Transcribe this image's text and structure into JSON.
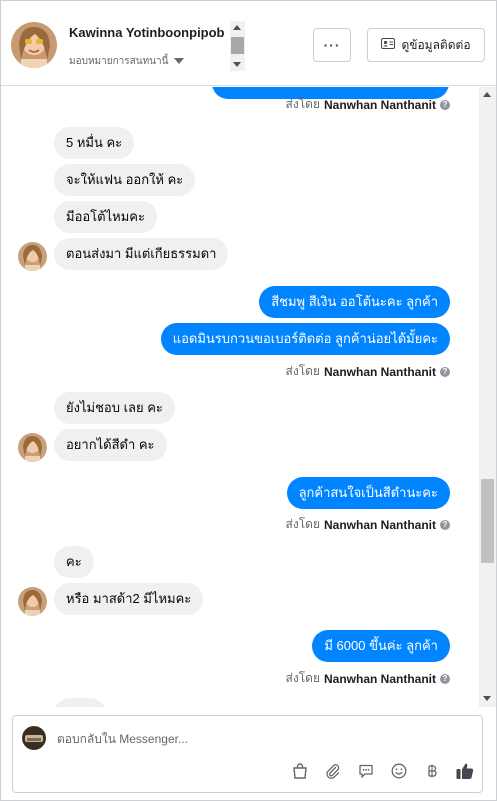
{
  "header": {
    "contact_name": "Kawinna Yotinboonpipob",
    "assign_label": "มอบหมายการสนทนานี้",
    "more_label": "···",
    "contact_info_label": "ดูข้อมูลติดต่อ"
  },
  "messages": [
    {
      "id": "m1",
      "direction": "in",
      "text": "5 หมื่น คะ"
    },
    {
      "id": "m2",
      "direction": "in",
      "text": "จะให้แฟน ออกให้ คะ"
    },
    {
      "id": "m3",
      "direction": "in",
      "text": "มีออโต้ไหมคะ"
    },
    {
      "id": "m4",
      "direction": "in",
      "text": "ตอนส่งมา มีแต่เกียธรรมดา"
    },
    {
      "id": "m5",
      "direction": "out",
      "text": "สีชมพู สีเงิน ออโต้นะคะ ลูกค้า"
    },
    {
      "id": "m6",
      "direction": "out",
      "text": "แอดมินรบกวนขอเบอร์ติดต่อ ลูกค้าน่อยได้มั้ยคะ"
    },
    {
      "id": "m7",
      "direction": "in",
      "text": "ยังไม่ชอบ เลย คะ"
    },
    {
      "id": "m8",
      "direction": "in",
      "text": "อยากได้สีดำ คะ"
    },
    {
      "id": "m9",
      "direction": "out",
      "text": "ลูกค้าสนใจเป็นสีดำนะคะ"
    },
    {
      "id": "m10",
      "direction": "in",
      "text": "คะ"
    },
    {
      "id": "m11",
      "direction": "in",
      "text": "หรือ มาสด้า2 มีไหมคะ"
    },
    {
      "id": "m12",
      "direction": "out",
      "text": "มี 6000 ขึ้นค่ะ ลูกค้า"
    }
  ],
  "sent_by": {
    "prefix": "ส่งโดย",
    "agent_name": "Nanwhan Nanthanit"
  },
  "composer": {
    "placeholder": "ตอบกลับใน Messenger..."
  },
  "icons": {
    "store": "shopping-bag-icon",
    "attach": "paperclip-icon",
    "saved_reply": "chat-bubble-icon",
    "emoji": "smiley-icon",
    "payment": "baht-icon",
    "like": "thumbs-up-icon"
  },
  "colors": {
    "outgoing_bubble": "#0084ff",
    "incoming_bubble": "#f0f0f0",
    "secondary_text": "#606770"
  }
}
